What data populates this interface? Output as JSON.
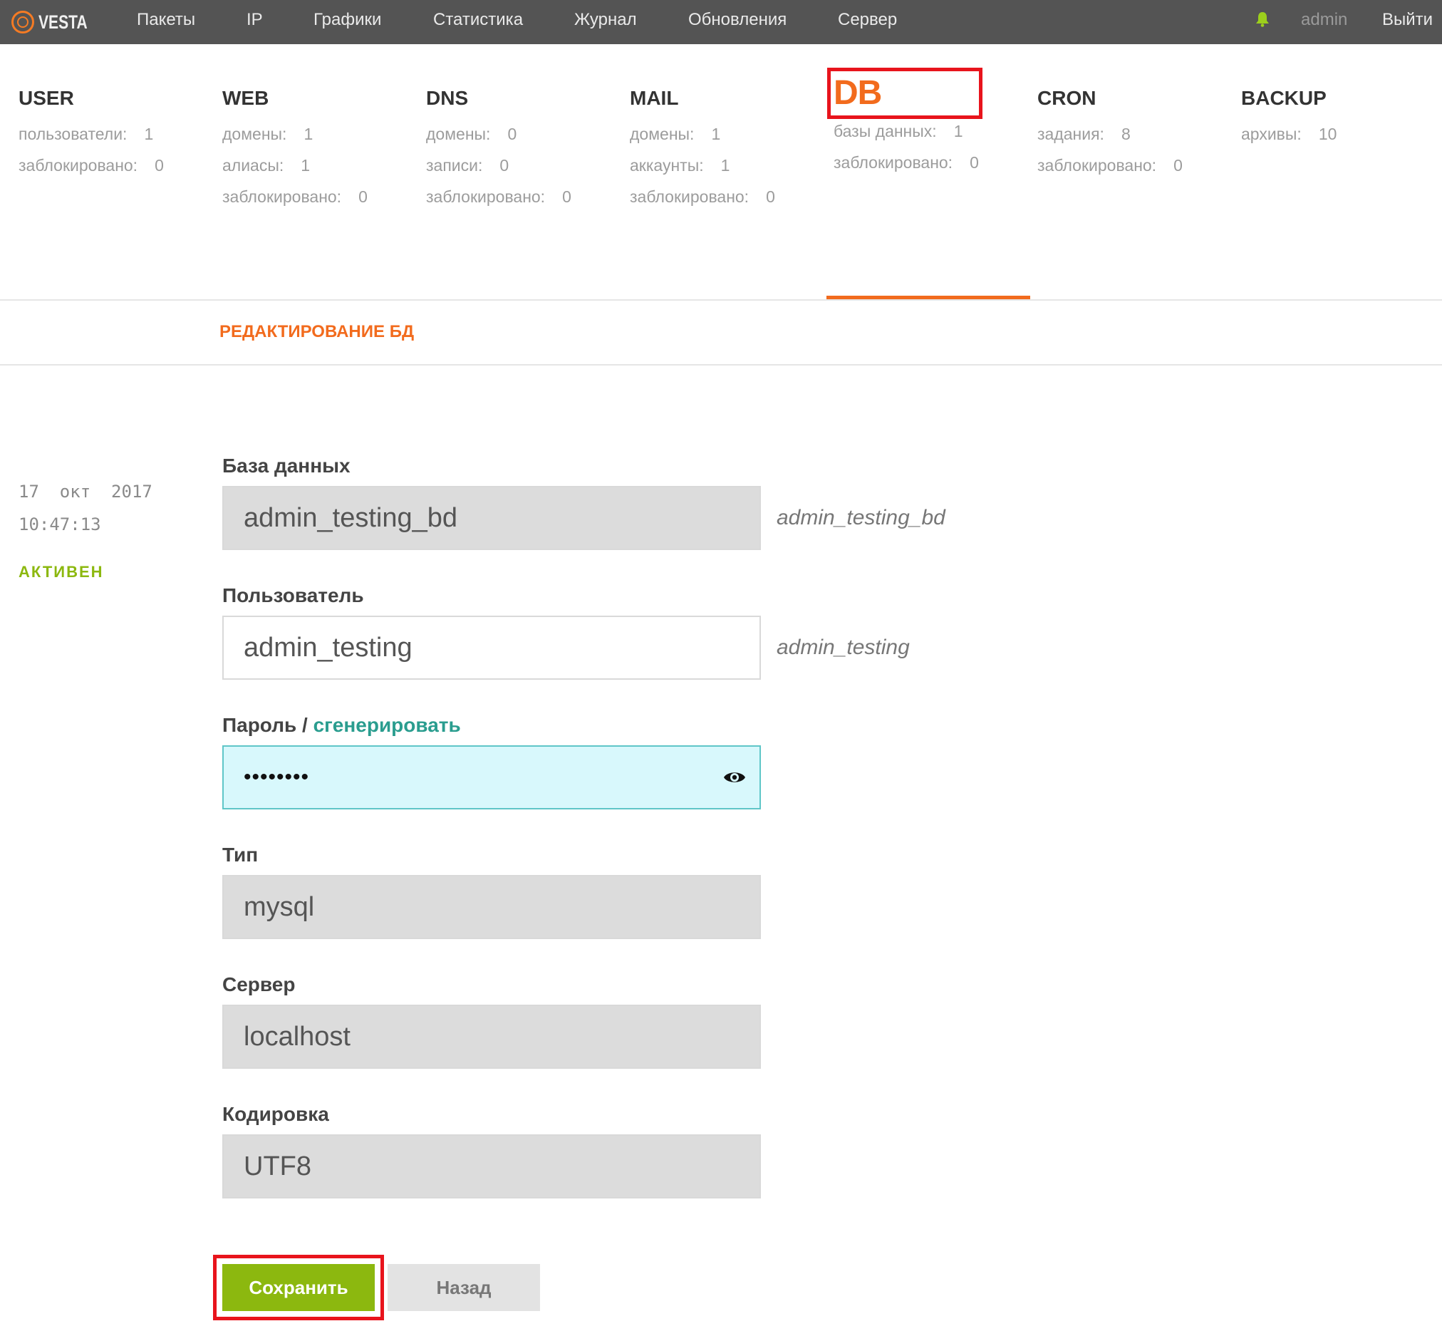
{
  "topbar": {
    "logo_text": "VESTA",
    "nav": [
      "Пакеты",
      "IP",
      "Графики",
      "Статистика",
      "Журнал",
      "Обновления",
      "Сервер"
    ],
    "user": "admin",
    "logout": "Выйти"
  },
  "stats": [
    {
      "title": "USER",
      "rows": [
        {
          "label": "пользователи:",
          "value": "1"
        },
        {
          "label": "заблокировано:",
          "value": "0"
        }
      ]
    },
    {
      "title": "WEB",
      "rows": [
        {
          "label": "домены:",
          "value": "1"
        },
        {
          "label": "алиасы:",
          "value": "1"
        },
        {
          "label": "заблокировано:",
          "value": "0"
        }
      ]
    },
    {
      "title": "DNS",
      "rows": [
        {
          "label": "домены:",
          "value": "0"
        },
        {
          "label": "записи:",
          "value": "0"
        },
        {
          "label": "заблокировано:",
          "value": "0"
        }
      ]
    },
    {
      "title": "MAIL",
      "rows": [
        {
          "label": "домены:",
          "value": "1"
        },
        {
          "label": "аккаунты:",
          "value": "1"
        },
        {
          "label": "заблокировано:",
          "value": "0"
        }
      ]
    },
    {
      "title": "DB",
      "rows": [
        {
          "label": "базы данных:",
          "value": "1"
        },
        {
          "label": "заблокировано:",
          "value": "0"
        }
      ]
    },
    {
      "title": "CRON",
      "rows": [
        {
          "label": "задания:",
          "value": "8"
        },
        {
          "label": "заблокировано:",
          "value": "0"
        }
      ]
    },
    {
      "title": "BACKUP",
      "rows": [
        {
          "label": "архивы:",
          "value": "10"
        }
      ]
    }
  ],
  "active_tab": "DB",
  "section_title": "РЕДАКТИРОВАНИЕ БД",
  "info": {
    "date": "17  окт  2017",
    "time": "10:47:13",
    "status": "АКТИВЕН"
  },
  "form": {
    "database": {
      "label": "База данных",
      "value": "admin_testing_bd",
      "hint": "admin_testing_bd"
    },
    "user": {
      "label": "Пользователь",
      "value": "admin_testing",
      "hint": "admin_testing"
    },
    "password": {
      "label": "Пароль",
      "separator": " / ",
      "generate": "сгенерировать",
      "value": "••••••••"
    },
    "type": {
      "label": "Тип",
      "value": "mysql"
    },
    "server": {
      "label": "Сервер",
      "value": "localhost"
    },
    "charset": {
      "label": "Кодировка",
      "value": "UTF8"
    }
  },
  "buttons": {
    "save": "Сохранить",
    "back": "Назад"
  },
  "colors": {
    "accent": "#f26b1d",
    "topbar": "#545454",
    "green": "#8cb80f",
    "highlight": "#e8141c"
  },
  "icons": [
    "vesta-logo-icon",
    "bell-icon",
    "eye-icon"
  ]
}
